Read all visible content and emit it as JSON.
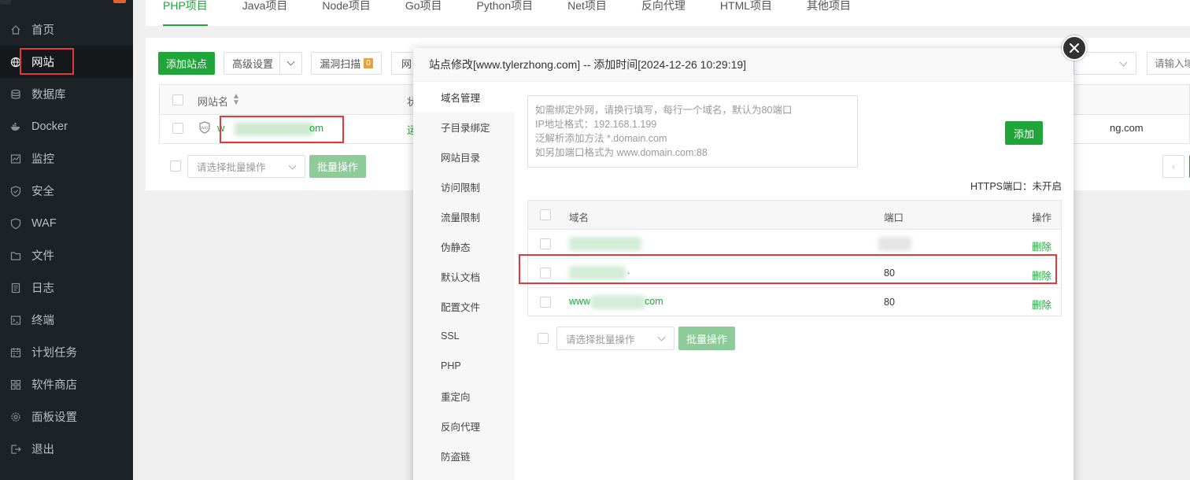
{
  "sidebar": {
    "items": [
      {
        "label": "首页",
        "icon": "home-icon"
      },
      {
        "label": "网站",
        "icon": "globe-icon"
      },
      {
        "label": "数据库",
        "icon": "database-icon"
      },
      {
        "label": "Docker",
        "icon": "docker-icon"
      },
      {
        "label": "监控",
        "icon": "monitor-icon"
      },
      {
        "label": "安全",
        "icon": "shield-icon"
      },
      {
        "label": "WAF",
        "icon": "waf-shield-icon"
      },
      {
        "label": "文件",
        "icon": "folder-icon"
      },
      {
        "label": "日志",
        "icon": "log-icon"
      },
      {
        "label": "终端",
        "icon": "terminal-icon"
      },
      {
        "label": "计划任务",
        "icon": "calendar-icon"
      },
      {
        "label": "软件商店",
        "icon": "grid-icon"
      },
      {
        "label": "面板设置",
        "icon": "gear-icon"
      },
      {
        "label": "退出",
        "icon": "logout-icon"
      }
    ],
    "active_index": 1
  },
  "tabs": [
    "PHP项目",
    "Java项目",
    "Node项目",
    "Go项目",
    "Python项目",
    "Net项目",
    "反向代理",
    "HTML项目",
    "其他项目"
  ],
  "toolbar": {
    "add_site": "添加站点",
    "advanced": "高级设置",
    "vuln_scan": "漏洞扫描",
    "vuln_count": "0",
    "partial_btn": "网",
    "search_placeholder": "请输入域"
  },
  "site_table": {
    "col_name": "网站名",
    "col_status_partial": "状",
    "row": {
      "name_prefix": "w",
      "name_suffix": "om",
      "status_partial": "运",
      "domain_partial": "ng.com"
    }
  },
  "bulk": {
    "placeholder": "请选择批量操作",
    "button": "批量操作"
  },
  "modal": {
    "title": "站点修改[www.tylerzhong.com] -- 添加时间[2024-12-26 10:29:19]",
    "nav": [
      "域名管理",
      "子目录绑定",
      "网站目录",
      "访问限制",
      "流量限制",
      "伪静态",
      "默认文档",
      "配置文件",
      "SSL",
      "PHP",
      "重定向",
      "反向代理",
      "防盗链"
    ],
    "textarea_lines": [
      "如需绑定外网，请换行填写，每行一个域名，默认为80端口",
      "IP地址格式：192.168.1.199",
      "泛解析添加方法 *.domain.com",
      "如另加端口格式为 www.domain.com:88"
    ],
    "add_button": "添加",
    "https_note": "HTTPS端口：未开启",
    "domain_table": {
      "col_domain": "域名",
      "col_port": "端口",
      "col_action": "操作",
      "rows": [
        {
          "domain": "",
          "port": "",
          "action": "删除"
        },
        {
          "domain": ".",
          "port": "80",
          "action": "删除"
        },
        {
          "domain_prefix": "www",
          "domain_suffix": "com",
          "port": "80",
          "action": "删除"
        }
      ]
    },
    "bulk_placeholder": "请选择批量操作",
    "bulk_button": "批量操作"
  },
  "colors": {
    "accent": "#20a53a",
    "sidebar_bg": "#1d2226",
    "highlight": "#e4393c"
  }
}
